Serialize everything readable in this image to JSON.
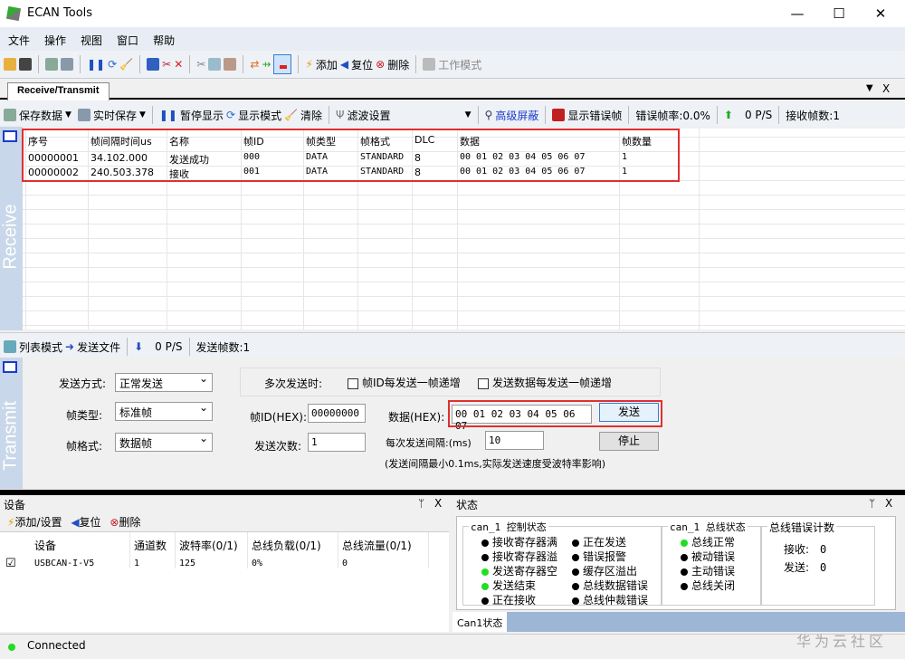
{
  "app": {
    "title": "ECAN Tools"
  },
  "menu": [
    "文件",
    "操作",
    "视图",
    "窗口",
    "帮助"
  ],
  "toolbar": {
    "add": "添加",
    "reset": "复位",
    "delete": "删除",
    "work_mode": "工作模式"
  },
  "tab": {
    "label": "Receive/Transmit",
    "close": "X"
  },
  "receive_toolbar": {
    "save_data": "保存数据",
    "realtime_save": "实时保存",
    "pause": "暂停显示",
    "display_mode": "显示模式",
    "clear": "清除",
    "filter": "滤波设置",
    "advanced_mask": "高级屏蔽",
    "show_error": "显示错误帧",
    "error_rate": "错误帧率:0.0%",
    "rate": "0 P/S",
    "recv_count": "接收帧数:1"
  },
  "receive": {
    "side_label": "Receive",
    "columns": [
      "序号",
      "帧间隔时间us",
      "名称",
      "帧ID",
      "帧类型",
      "帧格式",
      "DLC",
      "数据",
      "帧数量"
    ],
    "rows": [
      [
        "00000001",
        "34.102.000",
        "发送成功",
        "000",
        "DATA",
        "STANDARD",
        "8",
        "00 01 02 03 04 05 06 07",
        "1"
      ],
      [
        "00000002",
        "240.503.378",
        "接收",
        "001",
        "DATA",
        "STANDARD",
        "8",
        "00 01 02 03 04 05 06 07",
        "1"
      ]
    ]
  },
  "transmit_toolbar": {
    "list_mode": "列表模式",
    "send_file": "发送文件",
    "rate": "0 P/S",
    "send_count": "发送帧数:1"
  },
  "transmit": {
    "side_label": "Transmit",
    "send_mode_label": "发送方式:",
    "send_mode": "正常发送",
    "frame_type_label": "帧类型:",
    "frame_type": "标准帧",
    "frame_format_label": "帧格式:",
    "frame_format": "数据帧",
    "multi_label": "多次发送时:",
    "id_inc": "帧ID每发送一帧递增",
    "data_inc": "发送数据每发送一帧递增",
    "id_label": "帧ID(HEX):",
    "id_value": "00000000",
    "count_label": "发送次数:",
    "count_value": "1",
    "data_label": "数据(HEX):",
    "data_value": "00 01 02 03 04 05 06 07",
    "send_button": "发送",
    "interval_label": "每次发送间隔:(ms)",
    "interval_value": "10",
    "stop_button": "停止",
    "note": "(发送间隔最小0.1ms,实际发送速度受波特率影响)"
  },
  "device_panel": {
    "title": "设备",
    "pin": "ᛘ",
    "close": "X",
    "add": "添加/设置",
    "reset": "复位",
    "delete": "删除",
    "columns": [
      "设备",
      "通道数",
      "波特率(0/1)",
      "总线负载(0/1)",
      "总线流量(0/1)"
    ],
    "rows": [
      [
        "USBCAN-I-V5",
        "1",
        "125",
        "0%",
        "0"
      ]
    ]
  },
  "status_panel": {
    "title": "状态",
    "pin": "ᛘ",
    "close": "X",
    "control_title": "can_1 控制状态",
    "control": [
      {
        "label": "接收寄存器满",
        "on": false
      },
      {
        "label": "接收寄存器溢",
        "on": false
      },
      {
        "label": "发送寄存器空",
        "on": true
      },
      {
        "label": "发送结束",
        "on": true
      },
      {
        "label": "正在接收",
        "on": false
      },
      {
        "label": "正在发送",
        "on": false
      },
      {
        "label": "错误报警",
        "on": false
      },
      {
        "label": "缓存区溢出",
        "on": false
      },
      {
        "label": "总线数据错误",
        "on": false
      },
      {
        "label": "总线仲裁错误",
        "on": false
      }
    ],
    "bus_title": "can_1 总线状态",
    "bus": [
      {
        "label": "总线正常",
        "on": true
      },
      {
        "label": "被动错误",
        "on": false
      },
      {
        "label": "主动错误",
        "on": false
      },
      {
        "label": "总线关闭",
        "on": false
      }
    ],
    "err_title": "总线错误计数",
    "recv_label": "接收:",
    "recv_value": "0",
    "send_label": "发送:",
    "send_value": "0",
    "tab": "Can1状态"
  },
  "statusbar": {
    "text": "Connected",
    "watermark": "华为云社区"
  },
  "colors": {
    "highlight": "#e03030",
    "led_on": "#22dd22",
    "side_band": "#c9d7ea"
  }
}
